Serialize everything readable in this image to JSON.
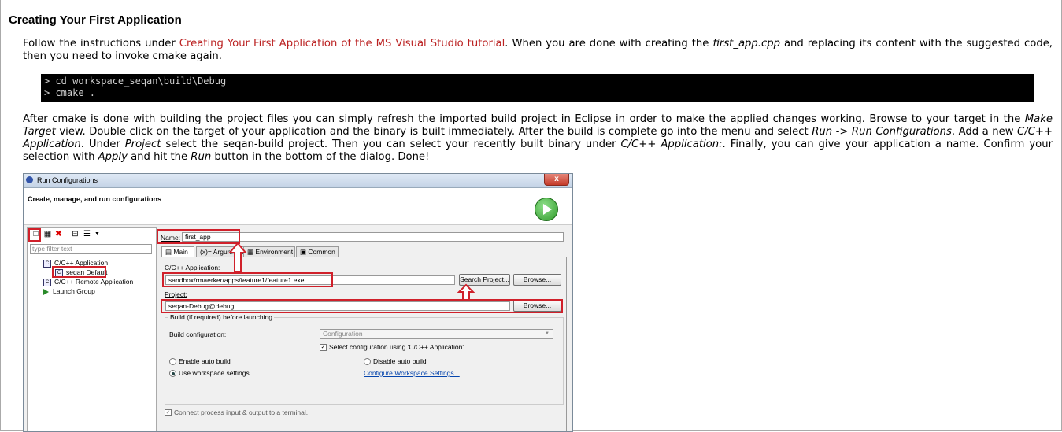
{
  "section_title": "Creating Your First Application",
  "p1": {
    "before": "Follow the instructions under ",
    "link": "Creating Your First Application of the MS Visual Studio tutorial",
    "middle": ". When you are done with creating the ",
    "file": "first_app.cpp",
    "after": " and replacing its content with the suggested code, then you need to invoke cmake again."
  },
  "code_lines": [
    "> cd workspace_seqan\\build\\Debug",
    "> cmake ."
  ],
  "p2": {
    "t1": "After cmake is done with building the project files you can simply refresh the imported build project in Eclipse in order to make the applied changes working. Browse to your target in the ",
    "i1": "Make Target",
    "t2": " view. Double click on the target of your application and the binary is built immediately. After the build is complete go into the menu and select ",
    "i2": "Run -> Run Configurations",
    "t3": ". Add a new ",
    "i3": "C/C++ Application",
    "t4": ". Under ",
    "i4": "Project",
    "t5": " select the seqan-build project. Then you can select your recently built binary under ",
    "i5": "C/C++ Application:",
    "t6": ". Finally, you can give your application a name. Confirm your selection with ",
    "i6": "Apply",
    "t7": " and hit the ",
    "i7": "Run",
    "t8": " button in the bottom of the dialog. Done!"
  },
  "dialog": {
    "title": "Run Configurations",
    "close": "x",
    "header": "Create, manage, and run configurations",
    "filter_placeholder": "type filter text",
    "tree": [
      {
        "label": "C/C++ Application",
        "icon": "c-icon"
      },
      {
        "label": "seqan Default",
        "icon": "c-icon"
      },
      {
        "label": "C/C++ Remote Application",
        "icon": "c-icon"
      },
      {
        "label": "Launch Group",
        "icon": "launch-icon"
      }
    ],
    "name_label": "Name:",
    "name_value": "first_app",
    "tabs": [
      "Main",
      "Arguments",
      "Environment",
      "Common"
    ],
    "app_label": "C/C++ Application:",
    "app_value": "sandbox/rmaerker/apps/feature1/feature1.exe",
    "search_project": "Search Project...",
    "browse": "Browse...",
    "project_label": "Project:",
    "project_value": "seqan-Debug@debug",
    "build_group": "Build (if required) before launching",
    "build_config_label": "Build configuration:",
    "build_config_value": "Configuration",
    "select_config": "Select configuration using 'C/C++ Application'",
    "enable_auto": "Enable auto build",
    "disable_auto": "Disable auto build",
    "use_workspace": "Use workspace settings",
    "configure_ws": "Configure Workspace Settings...",
    "connect_terminal": "Connect process input & output to a terminal."
  }
}
